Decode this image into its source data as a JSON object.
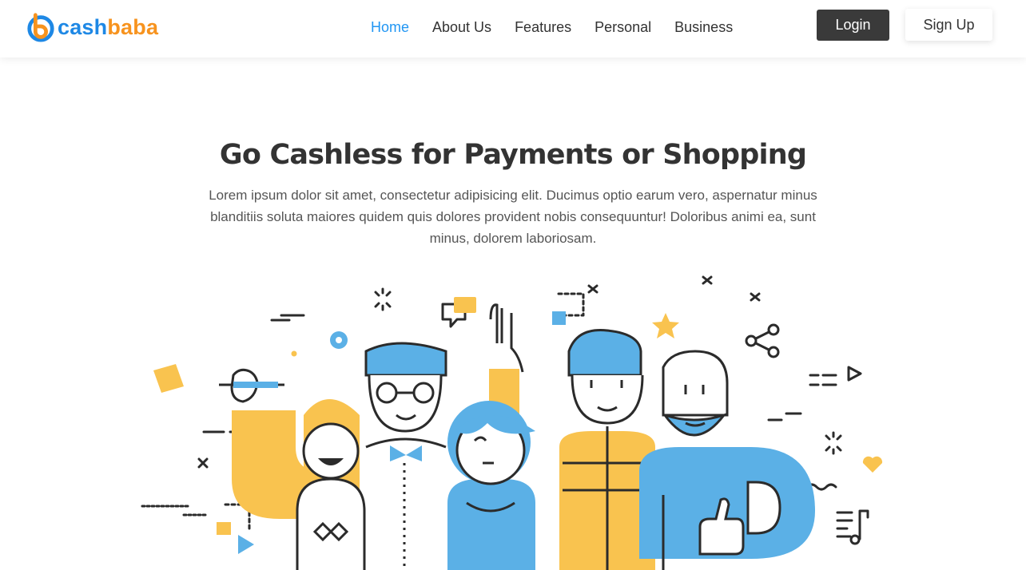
{
  "brand": {
    "name_part1": "cash",
    "name_part2": "baba",
    "colors": {
      "blue": "#1e88e5",
      "orange": "#f7931e"
    }
  },
  "nav": {
    "items": [
      {
        "label": "Home",
        "active": true
      },
      {
        "label": "About Us",
        "active": false
      },
      {
        "label": "Features",
        "active": false
      },
      {
        "label": "Personal",
        "active": false
      },
      {
        "label": "Business",
        "active": false
      }
    ],
    "active_color": "#2196f3"
  },
  "auth": {
    "login_label": "Login",
    "signup_label": "Sign Up"
  },
  "hero": {
    "title": "Go Cashless for Payments or Shopping",
    "text": "Lorem ipsum dolor sit amet, consectetur adipisicing elit. Ducimus optio earum vero, aspernatur minus blanditiis soluta maiores quidem quis dolores provident nobis consequuntur! Doloribus animi ea, sunt minus, dolorem laboriosam."
  },
  "illustration": {
    "icon": "people-group-illustration",
    "palette": {
      "yellow": "#f9c34f",
      "blue": "#5bb0e6",
      "line": "#2b2b2b"
    }
  }
}
